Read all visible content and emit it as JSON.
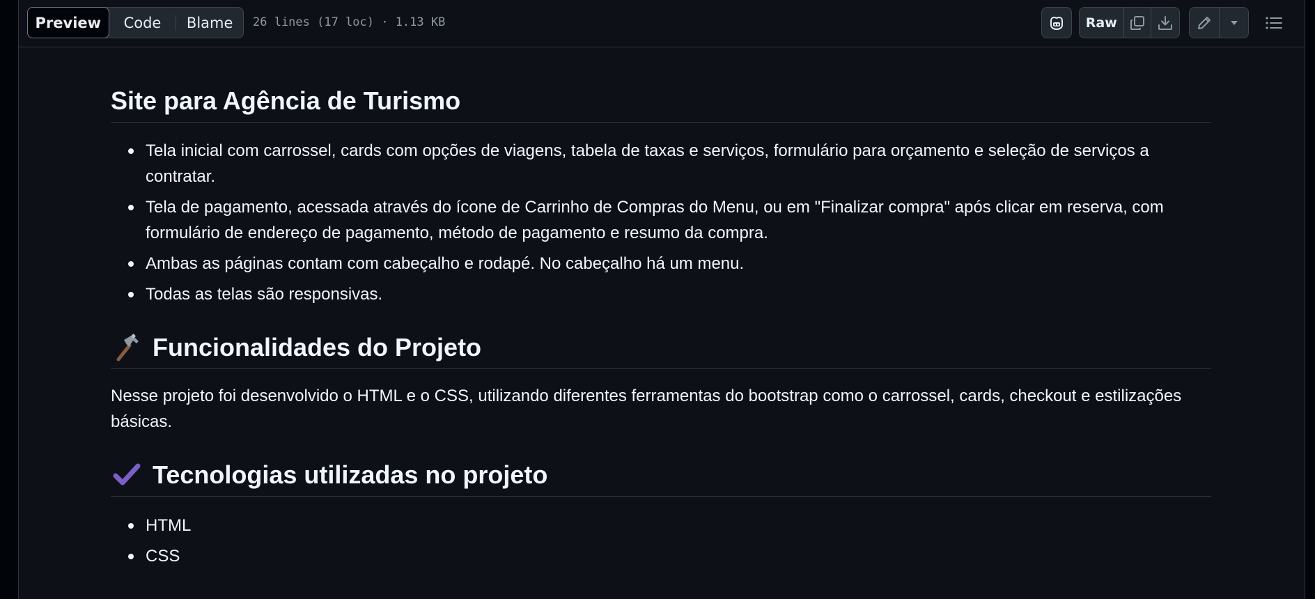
{
  "toolbar": {
    "tabs": [
      {
        "label": "Preview",
        "active": true
      },
      {
        "label": "Code",
        "active": false
      },
      {
        "label": "Blame",
        "active": false
      }
    ],
    "file_info": "26 lines (17 loc) · 1.13 KB",
    "raw_label": "Raw",
    "icons": [
      "copilot-icon",
      "copy-icon",
      "download-icon",
      "pencil-icon",
      "triangle-down-icon",
      "list-unordered-icon"
    ]
  },
  "readme": {
    "title": "Site para Agência de Turismo",
    "features": [
      "Tela inicial com carrossel, cards com opções de viagens, tabela de taxas e serviços, formulário para orçamento e seleção de serviços a contratar.",
      "Tela de pagamento, acessada através do ícone de Carrinho de Compras do Menu, ou em \"Finalizar compra\" após clicar em reserva, com formulário de endereço de pagamento, método de pagamento e resumo da compra.",
      "Ambas as páginas contam com cabeçalho e rodapé. No cabeçalho há um menu.",
      "Todas as telas são responsivas."
    ],
    "func_heading": "Funcionalidades do Projeto",
    "func_emoji": "hammer-icon",
    "func_text": "Nesse projeto foi desenvolvido o HTML e o CSS, utilizando diferentes ferramentas do bootstrap como o carrossel, cards, checkout e estilizações básicas.",
    "tech_heading": "Tecnologias utilizadas no projeto",
    "tech_emoji": "check-mark-icon",
    "technologies": [
      "HTML",
      "CSS"
    ]
  },
  "colors": {
    "background": "#0d1117",
    "text": "#f0f6fc",
    "muted": "#9198a1",
    "border": "#30363d",
    "check_purple": "#7b5fc9"
  }
}
